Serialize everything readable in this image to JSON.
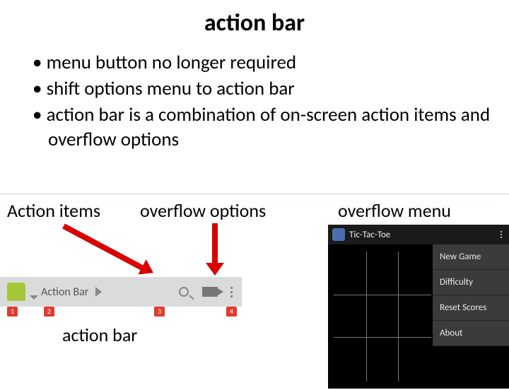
{
  "title": "action bar",
  "bullets": [
    "menu button no longer required",
    "shift options menu to action bar",
    "action bar is a combination of on-screen action items and overflow options"
  ],
  "labels": {
    "action_items": "Action items",
    "overflow_options": "overflow options",
    "overflow_menu": "overflow menu"
  },
  "caption": "action bar",
  "actionbar": {
    "title": "Action Bar",
    "markers": [
      "1",
      "2",
      "3",
      "4"
    ]
  },
  "overflow_mock": {
    "app_title": "Tic-Tac-Toe",
    "items": [
      "New Game",
      "Difficulty",
      "Reset Scores",
      "About"
    ]
  }
}
